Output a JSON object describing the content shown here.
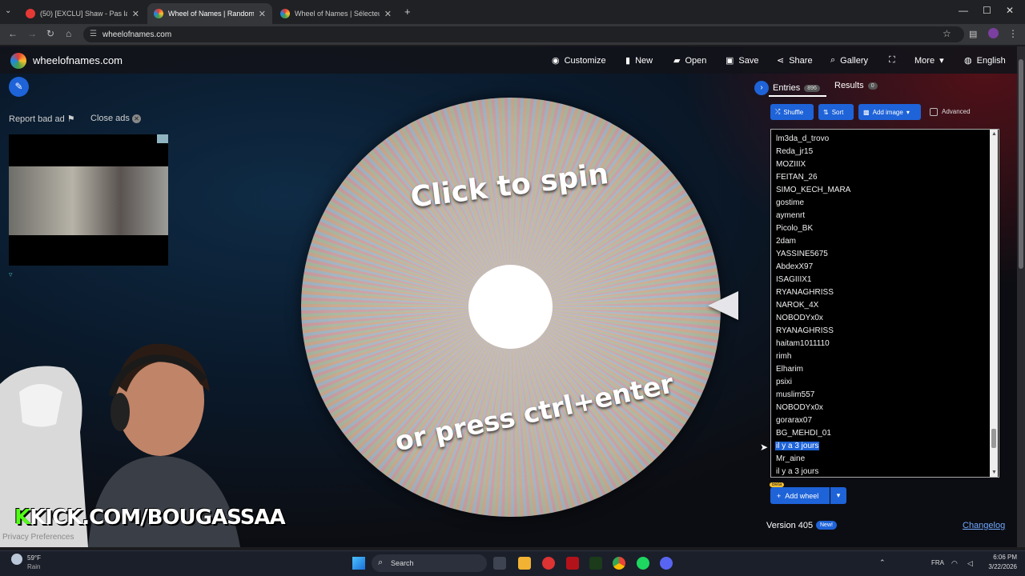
{
  "browser": {
    "tabs": [
      {
        "title": "(50) [EXCLU] Shaw - Pas la p",
        "active": false
      },
      {
        "title": "Wheel of Names | Random nam",
        "active": true
      },
      {
        "title": "Wheel of Names | Sélecteur de",
        "active": false
      }
    ],
    "new_tab": "+",
    "url": "wheelofnames.com"
  },
  "site": {
    "logo_text": "wheelofnames.com",
    "nav": {
      "customize": "Customize",
      "new": "New",
      "open": "Open",
      "save": "Save",
      "share": "Share",
      "gallery": "Gallery",
      "more": "More",
      "language": "English"
    }
  },
  "ads": {
    "report": "Report bad ad",
    "close": "Close ads"
  },
  "wheel": {
    "spin_text": "Click to spin",
    "press_text": "or press ctrl+enter"
  },
  "panel": {
    "entries_tab": "Entries",
    "entries_count": "896",
    "results_tab": "Results",
    "results_count": "0",
    "shuffle": "Shuffle",
    "sort": "Sort",
    "add_image": "Add image",
    "advanced": "Advanced",
    "entries": [
      "lm3da_d_trovo",
      "Reda_jr15",
      "MOZIIIX",
      "FEITAN_26",
      "SIMO_KECH_MARA",
      "gostime",
      "aymenrt",
      "Picolo_BK",
      "2dam",
      "YASSINE5675",
      "AbdexX97",
      "ISAGIIIX1",
      "RYANAGHRISS",
      "NAROK_4X",
      "NOBODYx0x",
      "RYANAGHRISS",
      "haitam1011110",
      "rimh",
      "Elharim",
      "psixi",
      "muslim557",
      "NOBODYx0x",
      "gorarax07",
      "BG_MEHDI_01",
      "il y a 3 jours",
      "Mr_aine",
      "il y a 3 jours"
    ],
    "selected_index": 24,
    "beta_badge": "Beta",
    "add_wheel": "Add wheel",
    "version": "Version 405",
    "new_badge": "New!",
    "changelog": "Changelog"
  },
  "overlay": {
    "kick_k": "K",
    "kick_text": "KICK.COM/BOUGASSAA",
    "privacy": "Privacy Preferences"
  },
  "taskbar": {
    "weather_temp": "59°F",
    "weather_desc": "Rain",
    "search": "Search",
    "lang": "FRA",
    "time": "6:06 PM",
    "date": "3/22/2026"
  },
  "colors": {
    "accent_blue": "#1e63d8",
    "kick_green": "#53fc18"
  }
}
